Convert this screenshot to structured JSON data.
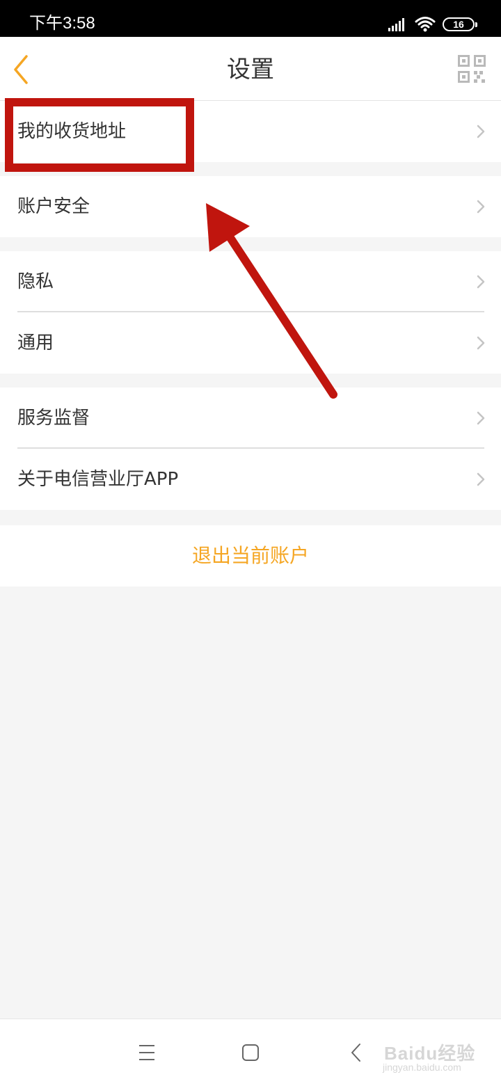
{
  "status_bar": {
    "time": "下午3:58",
    "battery": "16",
    "signal_icon": "signal-icon",
    "wifi_icon": "wifi-icon"
  },
  "header": {
    "title": "设置",
    "back_icon": "chevron-left-icon",
    "qr_icon": "qr-code-icon"
  },
  "colors": {
    "accent": "#f5a623",
    "annotation": "#c0150e",
    "background": "#f5f5f5",
    "text": "#333333"
  },
  "settings": {
    "address": "我的收货地址",
    "account_security": "账户安全",
    "privacy": "隐私",
    "general": "通用",
    "service_supervision": "服务监督",
    "about": "关于电信营业厅APP"
  },
  "logout": "退出当前账户",
  "watermark": {
    "brand": "Baidu经验",
    "sub": "jingyan.baidu.com"
  }
}
